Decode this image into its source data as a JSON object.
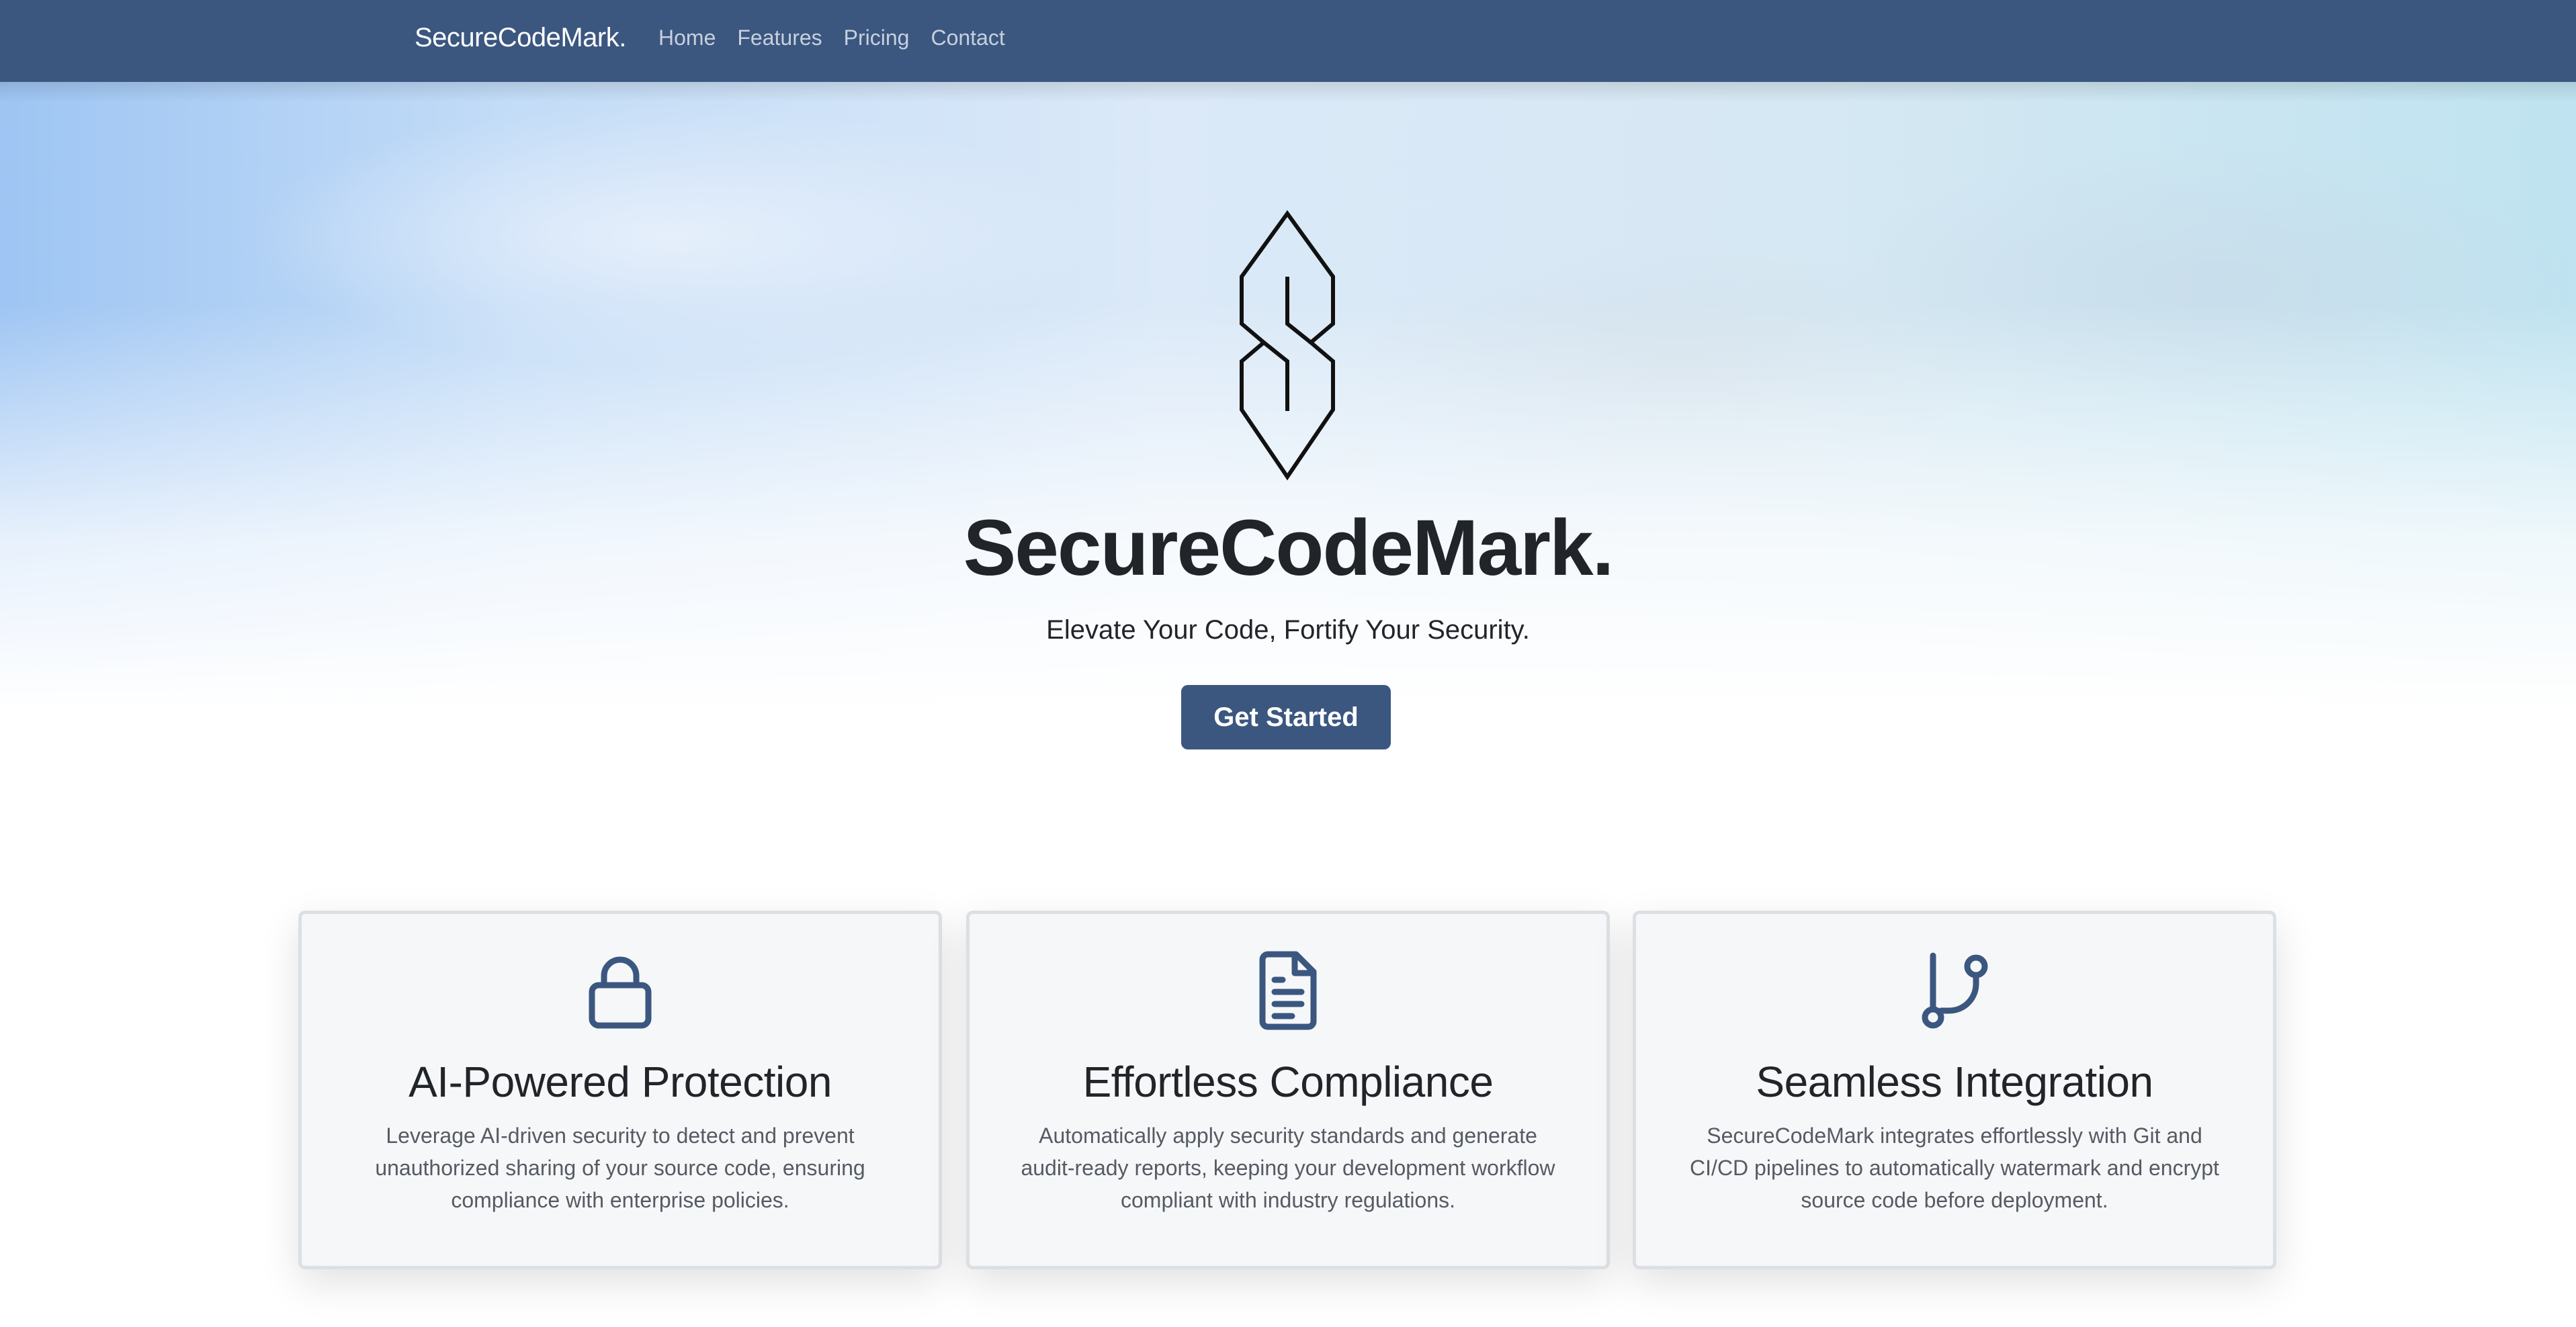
{
  "navbar": {
    "brand": "SecureCodeMark.",
    "links": [
      "Home",
      "Features",
      "Pricing",
      "Contact"
    ],
    "background_color": "#3b5780"
  },
  "hero": {
    "logo_icon": "stylized-s-logo-icon",
    "title": "SecureCodeMark.",
    "subtitle": "Elevate Your Code, Fortify Your Security.",
    "cta_label": "Get Started"
  },
  "features": [
    {
      "icon": "lock-icon",
      "title": "AI-Powered Protection",
      "text": "Leverage AI-driven security to detect and prevent unauthorized sharing of your source code, ensuring compliance with enterprise policies."
    },
    {
      "icon": "document-icon",
      "title": "Effortless Compliance",
      "text": "Automatically apply security standards and generate audit-ready reports, keeping your development workflow compliant with industry regulations."
    },
    {
      "icon": "git-branch-icon",
      "title": "Seamless Integration",
      "text": "SecureCodeMark integrates effortlessly with Git and CI/CD pipelines to automatically watermark and encrypt source code before deployment."
    }
  ],
  "colors": {
    "accent": "#3b5780",
    "icon": "#3b5780",
    "text_dark": "#212529",
    "text_muted": "#555b62"
  }
}
